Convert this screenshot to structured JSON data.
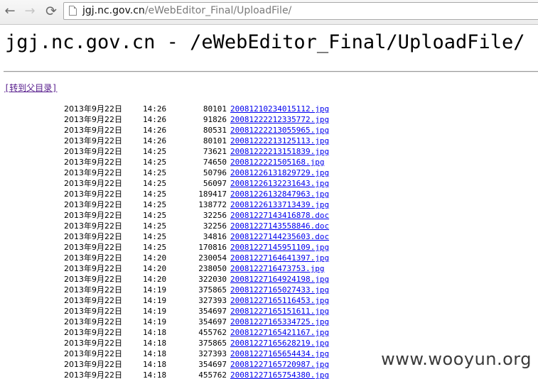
{
  "browser": {
    "back_icon": "←",
    "forward_icon": "→",
    "reload_icon": "⟳",
    "url_host": "jgj.nc.gov.cn",
    "url_path": "/eWebEditor_Final/UploadFile/"
  },
  "page": {
    "title": "jgj.nc.gov.cn - /eWebEditor_Final/UploadFile/",
    "parent_link": "[转到父目录]"
  },
  "files": [
    {
      "date": "2013年9月22日",
      "time": "14:26",
      "size": "80101",
      "name": "20081210234015112.jpg"
    },
    {
      "date": "2013年9月22日",
      "time": "14:26",
      "size": "91826",
      "name": "20081222212335772.jpg"
    },
    {
      "date": "2013年9月22日",
      "time": "14:26",
      "size": "80531",
      "name": "20081222213055965.jpg"
    },
    {
      "date": "2013年9月22日",
      "time": "14:26",
      "size": "80101",
      "name": "20081222213125113.jpg"
    },
    {
      "date": "2013年9月22日",
      "time": "14:25",
      "size": "73621",
      "name": "20081222213151839.jpg"
    },
    {
      "date": "2013年9月22日",
      "time": "14:25",
      "size": "74650",
      "name": "2008122221505168.jpg"
    },
    {
      "date": "2013年9月22日",
      "time": "14:25",
      "size": "50796",
      "name": "20081226131829729.jpg"
    },
    {
      "date": "2013年9月22日",
      "time": "14:25",
      "size": "56097",
      "name": "20081226132231643.jpg"
    },
    {
      "date": "2013年9月22日",
      "time": "14:25",
      "size": "189417",
      "name": "20081226132847963.jpg"
    },
    {
      "date": "2013年9月22日",
      "time": "14:25",
      "size": "138772",
      "name": "20081226133713439.jpg"
    },
    {
      "date": "2013年9月22日",
      "time": "14:25",
      "size": "32256",
      "name": "20081227143416878.doc"
    },
    {
      "date": "2013年9月22日",
      "time": "14:25",
      "size": "32256",
      "name": "20081227143558846.doc"
    },
    {
      "date": "2013年9月22日",
      "time": "14:25",
      "size": "34816",
      "name": "20081227144235603.doc"
    },
    {
      "date": "2013年9月22日",
      "time": "14:25",
      "size": "170816",
      "name": "20081227145951109.jpg"
    },
    {
      "date": "2013年9月22日",
      "time": "14:20",
      "size": "230054",
      "name": "20081227164641397.jpg"
    },
    {
      "date": "2013年9月22日",
      "time": "14:20",
      "size": "238050",
      "name": "2008122716473753.jpg"
    },
    {
      "date": "2013年9月22日",
      "time": "14:20",
      "size": "322030",
      "name": "20081227164924198.jpg"
    },
    {
      "date": "2013年9月22日",
      "time": "14:19",
      "size": "375865",
      "name": "20081227165027433.jpg"
    },
    {
      "date": "2013年9月22日",
      "time": "14:19",
      "size": "327393",
      "name": "20081227165116453.jpg"
    },
    {
      "date": "2013年9月22日",
      "time": "14:19",
      "size": "354697",
      "name": "20081227165151611.jpg"
    },
    {
      "date": "2013年9月22日",
      "time": "14:19",
      "size": "354697",
      "name": "20081227165334725.jpg"
    },
    {
      "date": "2013年9月22日",
      "time": "14:18",
      "size": "455762",
      "name": "20081227165421167.jpg"
    },
    {
      "date": "2013年9月22日",
      "time": "14:18",
      "size": "375865",
      "name": "20081227165628219.jpg"
    },
    {
      "date": "2013年9月22日",
      "time": "14:18",
      "size": "327393",
      "name": "20081227165654434.jpg"
    },
    {
      "date": "2013年9月22日",
      "time": "14:18",
      "size": "354697",
      "name": "20081227165720987.jpg"
    },
    {
      "date": "2013年9月22日",
      "time": "14:18",
      "size": "455762",
      "name": "20081227165754380.jpg"
    }
  ],
  "watermark": "www.wooyun.org"
}
